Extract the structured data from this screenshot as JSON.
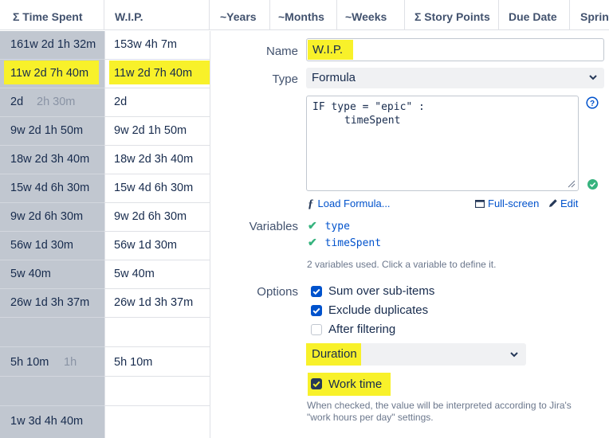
{
  "header": {
    "columns": [
      "Σ Time Spent",
      "W.I.P.",
      "~Years",
      "~Months",
      "~Weeks",
      "Σ Story Points",
      "Due Date",
      "Sprint"
    ]
  },
  "rows": [
    {
      "time_spent": "161w 2d 1h 32m",
      "time_spent_extra": "",
      "wip": "153w 4h 7m"
    },
    {
      "time_spent": "11w 2d 7h 40m",
      "time_spent_extra": "",
      "wip": "11w 2d 7h 40m"
    },
    {
      "time_spent": "2d",
      "time_spent_extra": "2h 30m",
      "wip": "2d"
    },
    {
      "time_spent": "9w 2d 1h 50m",
      "time_spent_extra": "",
      "wip": "9w 2d 1h 50m"
    },
    {
      "time_spent": "18w 2d 3h 40m",
      "time_spent_extra": "",
      "wip": "18w 2d 3h 40m"
    },
    {
      "time_spent": "15w 4d 6h 30m",
      "time_spent_extra": "",
      "wip": "15w 4d 6h 30m"
    },
    {
      "time_spent": "9w 2d 6h 30m",
      "time_spent_extra": "",
      "wip": "9w 2d 6h 30m"
    },
    {
      "time_spent": "56w 1d 30m",
      "time_spent_extra": "",
      "wip": "56w 1d 30m"
    },
    {
      "time_spent": "5w 40m",
      "time_spent_extra": "",
      "wip": "5w 40m"
    },
    {
      "time_spent": "26w 1d 3h 37m",
      "time_spent_extra": "",
      "wip": "26w 1d 3h 37m"
    },
    {
      "time_spent": "",
      "time_spent_extra": "",
      "wip": ""
    },
    {
      "time_spent": "5h 10m",
      "time_spent_extra": "1h",
      "wip": "5h 10m"
    },
    {
      "time_spent": "",
      "time_spent_extra": "",
      "wip": ""
    },
    {
      "time_spent": "1w 3d 4h 40m",
      "time_spent_extra": "",
      "wip": ""
    }
  ],
  "panel": {
    "name_label": "Name",
    "name_value": "W.I.P.",
    "type_label": "Type",
    "type_value": "Formula",
    "formula_line1": "IF type = \"epic\" :",
    "formula_line2": "timeSpent",
    "help_icon": "question-circle-icon",
    "valid_icon": "check-circle-icon",
    "load_formula": "Load Formula...",
    "full_screen": "Full-screen",
    "edit": "Edit",
    "variables_label": "Variables",
    "variables": [
      "type",
      "timeSpent"
    ],
    "variables_hint": "2 variables used. Click a variable to define it.",
    "options_label": "Options",
    "options": [
      {
        "label": "Sum over sub-items",
        "checked": true
      },
      {
        "label": "Exclude duplicates",
        "checked": true
      },
      {
        "label": "After filtering",
        "checked": false
      }
    ],
    "format_value": "Duration",
    "work_time_label": "Work time",
    "work_time_checked": true,
    "work_time_hint_line1": "When checked, the value will be interpreted according to Jira's",
    "work_time_hint_line2": "\"work hours per day\" settings."
  },
  "colors": {
    "highlight": "#f8f12a",
    "accent": "#0052cc",
    "valid": "#36b37e",
    "selected_column": "#c1c7d0"
  }
}
